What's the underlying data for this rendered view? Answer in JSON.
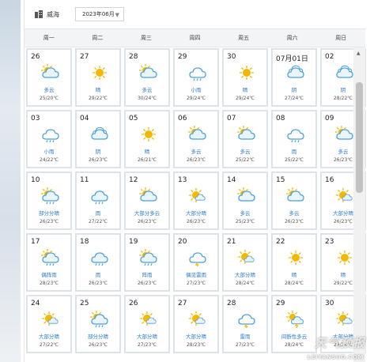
{
  "toolbar": {
    "city": "威海",
    "month": "2023年06月"
  },
  "weekdays": [
    "周一",
    "周二",
    "周三",
    "周四",
    "周五",
    "周六",
    "周日"
  ],
  "days": [
    {
      "d": "26",
      "cond": "多云",
      "tmp": "25/20℃",
      "icon": "partly-cloudy"
    },
    {
      "d": "27",
      "cond": "晴",
      "tmp": "29/22℃",
      "icon": "sunny"
    },
    {
      "d": "28",
      "cond": "多云",
      "tmp": "30/24℃",
      "icon": "partly-cloudy"
    },
    {
      "d": "29",
      "cond": "小雨",
      "tmp": "29/24℃",
      "icon": "light-rain"
    },
    {
      "d": "30",
      "cond": "晴",
      "tmp": "29/24℃",
      "icon": "sunny"
    },
    {
      "d": "07月01日",
      "cond": "阴",
      "tmp": "27/24℃",
      "icon": "cloudy"
    },
    {
      "d": "02",
      "cond": "阴",
      "tmp": "28/22℃",
      "icon": "cloudy"
    },
    {
      "d": "03",
      "cond": "小雨",
      "tmp": "24/22℃",
      "icon": "light-rain"
    },
    {
      "d": "04",
      "cond": "阴",
      "tmp": "26/23℃",
      "icon": "cloudy"
    },
    {
      "d": "05",
      "cond": "晴",
      "tmp": "26/21℃",
      "icon": "sunny"
    },
    {
      "d": "06",
      "cond": "多云",
      "tmp": "26/23℃",
      "icon": "partly-cloudy"
    },
    {
      "d": "07",
      "cond": "多云",
      "tmp": "25/22℃",
      "icon": "partly-cloudy"
    },
    {
      "d": "08",
      "cond": "雨",
      "tmp": "25/22℃",
      "icon": "light-rain"
    },
    {
      "d": "09",
      "cond": "多云",
      "tmp": "26/23℃",
      "icon": "partly-cloudy"
    },
    {
      "d": "10",
      "cond": "部分分晴",
      "tmp": "26/23℃",
      "icon": "sun-rain"
    },
    {
      "d": "11",
      "cond": "雨",
      "tmp": "27/22℃",
      "icon": "rain"
    },
    {
      "d": "12",
      "cond": "大部分多云",
      "tmp": "26/23℃",
      "icon": "partly-cloudy"
    },
    {
      "d": "13",
      "cond": "大部分晴",
      "tmp": "26/23℃",
      "icon": "mostly-sunny"
    },
    {
      "d": "14",
      "cond": "多云",
      "tmp": "25/23℃",
      "icon": "partly-cloudy"
    },
    {
      "d": "15",
      "cond": "多云",
      "tmp": "26/23℃",
      "icon": "partly-cloudy"
    },
    {
      "d": "16",
      "cond": "大部分晴",
      "tmp": "26/23℃",
      "icon": "mostly-sunny"
    },
    {
      "d": "17",
      "cond": "偶阵雨",
      "tmp": "28/23℃",
      "icon": "sun-rain"
    },
    {
      "d": "18",
      "cond": "雨",
      "tmp": "26/23℃",
      "icon": "rain"
    },
    {
      "d": "19",
      "cond": "阵雨",
      "tmp": "26/23℃",
      "icon": "sun-rain"
    },
    {
      "d": "20",
      "cond": "偶见雷雨",
      "tmp": "27/23℃",
      "icon": "thunder"
    },
    {
      "d": "21",
      "cond": "大部分晴",
      "tmp": "28/24℃",
      "icon": "mostly-sunny"
    },
    {
      "d": "22",
      "cond": "晴",
      "tmp": "28/24℃",
      "icon": "sunny"
    },
    {
      "d": "23",
      "cond": "晴",
      "tmp": "29/22℃",
      "icon": "sunny"
    },
    {
      "d": "24",
      "cond": "大部分晴",
      "tmp": "27/22℃",
      "icon": "mostly-sunny"
    },
    {
      "d": "25",
      "cond": "部分分晴",
      "tmp": "26/23℃",
      "icon": "sun-rain"
    },
    {
      "d": "26",
      "cond": "大部分晴",
      "tmp": "27/23℃",
      "icon": "mostly-sunny"
    },
    {
      "d": "27",
      "cond": "大部分晴",
      "tmp": "28/23℃",
      "icon": "mostly-sunny"
    },
    {
      "d": "28",
      "cond": "雷雨",
      "tmp": "27/23℃",
      "icon": "thunder"
    },
    {
      "d": "29",
      "cond": "间断性多云",
      "tmp": "28/24℃",
      "icon": "sun-storm"
    },
    {
      "d": "30",
      "cond": "大部分晴",
      "tmp": "29/24℃",
      "icon": "mostly-sunny"
    }
  ],
  "watermark": {
    "line1": "天气预报",
    "line2": "LEIYANSUO.COM"
  },
  "colors": {
    "accent": "#2b7bd0",
    "sun": "#f5b700",
    "cloud": "#4ea1d8",
    "border": "#dde3ea"
  }
}
